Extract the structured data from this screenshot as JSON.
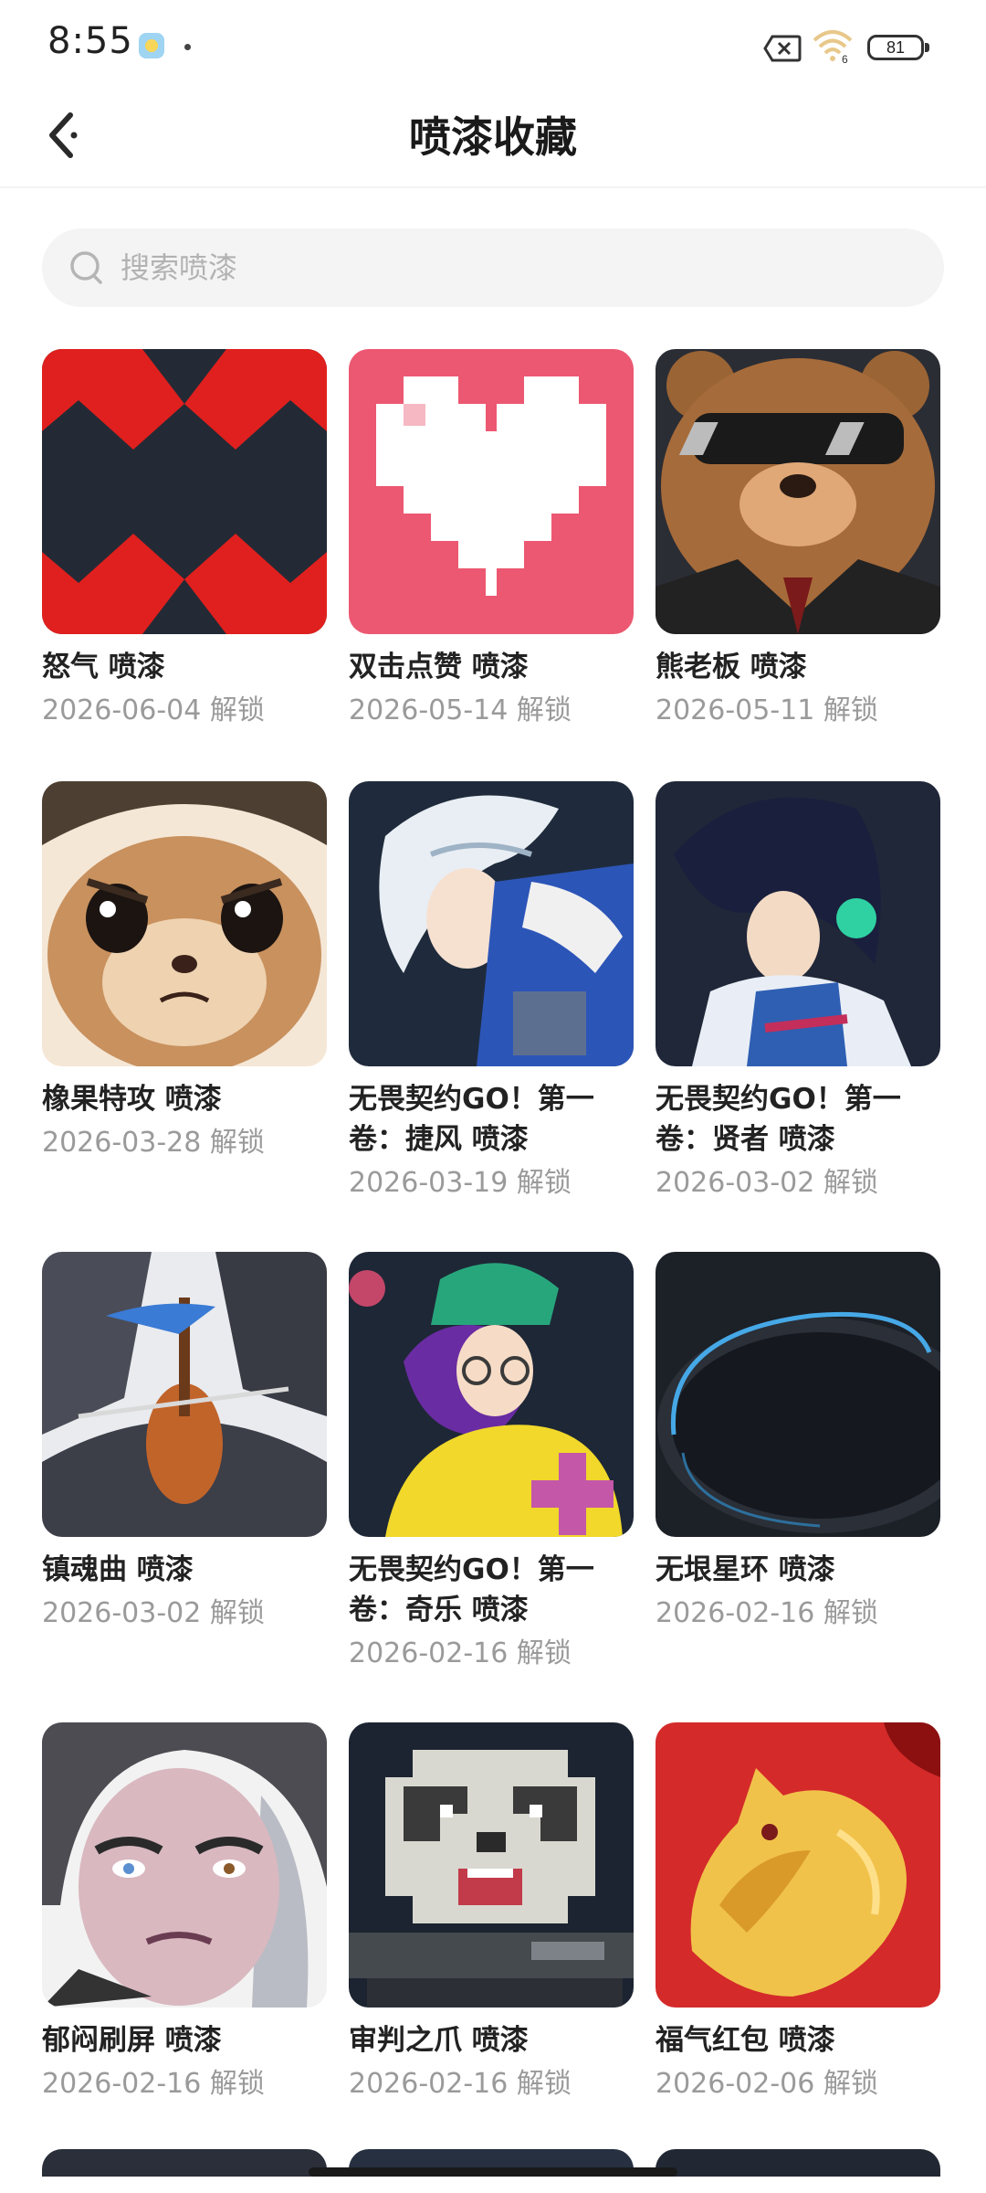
{
  "status_bar": {
    "time": "8:55",
    "battery": "81",
    "battery_level": 0.81,
    "wifi_label": "6"
  },
  "header": {
    "title": "喷漆收藏"
  },
  "search": {
    "placeholder": "搜索喷漆"
  },
  "sprays": [
    {
      "name": "怒气 喷漆",
      "date": "2026-06-04 解锁",
      "icon": "red-x-spray"
    },
    {
      "name": "双击点赞 喷漆",
      "date": "2026-05-14 解锁",
      "icon": "pixel-heart-spray"
    },
    {
      "name": "熊老板 喷漆",
      "date": "2026-05-11 解锁",
      "icon": "bear-sunglasses-spray"
    },
    {
      "name": "橡果特攻 喷漆",
      "date": "2026-03-28 解锁",
      "icon": "squirrel-spray"
    },
    {
      "name": "无畏契约GO！第一卷：捷风 喷漆",
      "date": "2026-03-19 解锁",
      "icon": "jett-spray"
    },
    {
      "name": "无畏契约GO！第一卷：贤者 喷漆",
      "date": "2026-03-02 解锁",
      "icon": "sage-spray"
    },
    {
      "name": "镇魂曲 喷漆",
      "date": "2026-03-02 解锁",
      "icon": "violin-spray"
    },
    {
      "name": "无畏契约GO！第一卷：奇乐 喷漆",
      "date": "2026-02-16 解锁",
      "icon": "killjoy-spray"
    },
    {
      "name": "无垠星环 喷漆",
      "date": "2026-02-16 解锁",
      "icon": "ring-spray"
    },
    {
      "name": "郁闷刷屏 喷漆",
      "date": "2026-02-16 解锁",
      "icon": "grumpy-face-spray"
    },
    {
      "name": "审判之爪 喷漆",
      "date": "2026-02-16 解锁",
      "icon": "pixel-sloth-spray"
    },
    {
      "name": "福气红包 喷漆",
      "date": "2026-02-06 解锁",
      "icon": "golden-horse-spray"
    }
  ],
  "colors": {
    "title": "#1a1a1a",
    "date_text": "#9a9a9a",
    "search_bg": "#f4f4f4"
  }
}
